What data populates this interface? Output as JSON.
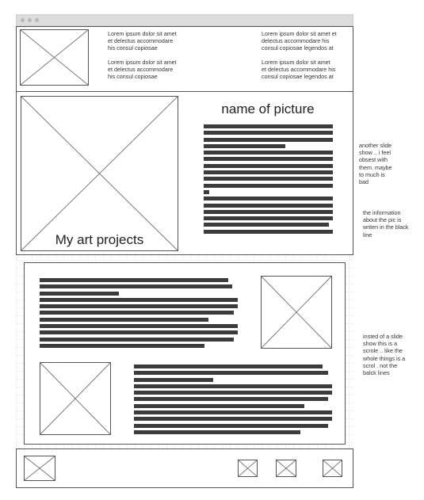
{
  "header": {
    "text_blocks": [
      [
        "Lorem ipsum dolor sit amet",
        "et delectus accommodare",
        "his consul copiosae"
      ],
      [
        "Lorem ipsum dolor sit amet",
        "et delectus accommodare",
        "his consul copiosae"
      ],
      [
        "Lorem ipsum dolor sit amet et",
        "delectus accommodare his",
        "consul copiosae legendos at"
      ],
      [
        "Lorem ipsum dolor sit amet",
        "et delectus accommodare his",
        "consul copiosae legendos at"
      ]
    ]
  },
  "hero": {
    "art_title": "My art projects",
    "picture_name": "name of picture",
    "description_lines": [
      100,
      100,
      100,
      63,
      100,
      100,
      100,
      100,
      100,
      100,
      4,
      100,
      100,
      100,
      100,
      97,
      100
    ]
  },
  "content": {
    "top_lines": [
      95,
      97,
      40,
      100,
      100,
      98,
      85,
      100,
      100,
      98,
      83
    ],
    "bottom_lines": [
      95,
      98,
      40,
      100,
      100,
      98,
      86,
      100,
      100,
      98,
      84
    ]
  },
  "notes": [
    [
      "another slide",
      "show .. i feel",
      "obsest with",
      "them. maybe",
      "to much is",
      "bad"
    ],
    [
      "the information",
      "about the pic is",
      "writen in the black",
      "line"
    ],
    [
      "insted of a slide",
      "show this is a",
      "scrole .. like the",
      "whole things is a",
      "scrol . not the",
      "balck lines"
    ]
  ]
}
